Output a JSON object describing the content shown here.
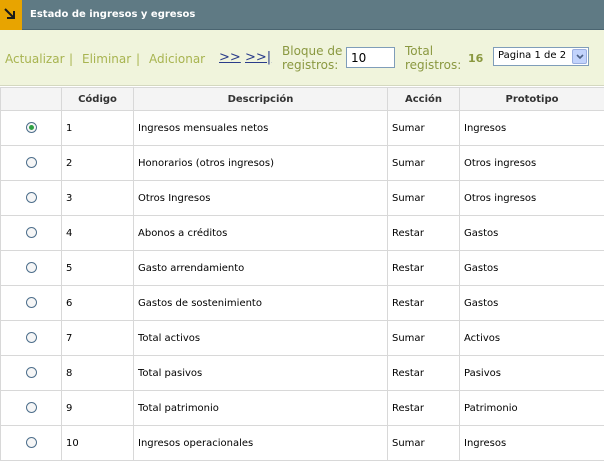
{
  "title": "Estado de ingresos y egresos",
  "toolbar": {
    "actualizar": "Actualizar",
    "eliminar": "Eliminar",
    "adicionar": "Adicionar",
    "separator": "|",
    "next": ">>",
    "last": ">>|",
    "bloque_label_1": "Bloque de",
    "bloque_label_2": "registros:",
    "bloque_value": "10",
    "total_label_1": "Total",
    "total_label_2": "registros:",
    "total_count": "16",
    "page_selected": "Pagina 1 de 2"
  },
  "colors": {
    "titlebar": "#5f7a84",
    "toolbar_bg": "#f0f4dc",
    "accent": "#e8a400",
    "link": "#a8b450"
  },
  "table": {
    "headers": [
      "",
      "Código",
      "Descripción",
      "Acción",
      "Prototipo"
    ],
    "rows": [
      {
        "selected": true,
        "codigo": "1",
        "descripcion": "Ingresos mensuales netos",
        "accion": "Sumar",
        "prototipo": "Ingresos"
      },
      {
        "selected": false,
        "codigo": "2",
        "descripcion": "Honorarios (otros ingresos)",
        "accion": "Sumar",
        "prototipo": "Otros ingresos"
      },
      {
        "selected": false,
        "codigo": "3",
        "descripcion": "Otros Ingresos",
        "accion": "Sumar",
        "prototipo": "Otros ingresos"
      },
      {
        "selected": false,
        "codigo": "4",
        "descripcion": "Abonos a créditos",
        "accion": "Restar",
        "prototipo": "Gastos"
      },
      {
        "selected": false,
        "codigo": "5",
        "descripcion": "Gasto arrendamiento",
        "accion": "Restar",
        "prototipo": "Gastos"
      },
      {
        "selected": false,
        "codigo": "6",
        "descripcion": "Gastos de sostenimiento",
        "accion": "Restar",
        "prototipo": "Gastos"
      },
      {
        "selected": false,
        "codigo": "7",
        "descripcion": "Total activos",
        "accion": "Sumar",
        "prototipo": "Activos"
      },
      {
        "selected": false,
        "codigo": "8",
        "descripcion": "Total pasivos",
        "accion": "Restar",
        "prototipo": "Pasivos"
      },
      {
        "selected": false,
        "codigo": "9",
        "descripcion": "Total patrimonio",
        "accion": "Restar",
        "prototipo": "Patrimonio"
      },
      {
        "selected": false,
        "codigo": "10",
        "descripcion": "Ingresos operacionales",
        "accion": "Sumar",
        "prototipo": "Ingresos"
      }
    ]
  }
}
